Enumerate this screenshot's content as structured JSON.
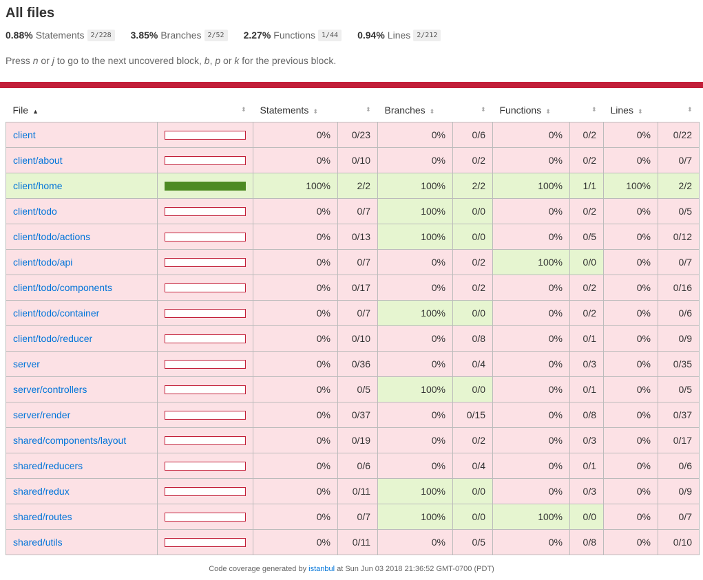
{
  "title": "All files",
  "summary": [
    {
      "pct": "0.88%",
      "label": "Statements",
      "fraction": "2/228"
    },
    {
      "pct": "3.85%",
      "label": "Branches",
      "fraction": "2/52"
    },
    {
      "pct": "2.27%",
      "label": "Functions",
      "fraction": "1/44"
    },
    {
      "pct": "0.94%",
      "label": "Lines",
      "fraction": "2/212"
    }
  ],
  "hint": {
    "p1": "Press ",
    "k1": "n",
    "p2": " or ",
    "k2": "j",
    "p3": " to go to the next uncovered block, ",
    "k3": "b",
    "p4": ", ",
    "k4": "p",
    "p5": " or ",
    "k5": "k",
    "p6": " for the previous block."
  },
  "headers": {
    "file": "File",
    "statements": "Statements",
    "branches": "Branches",
    "functions": "Functions",
    "lines": "Lines"
  },
  "colors": {
    "low": "#fce1e5",
    "high": "#e6f5d0",
    "bar_red": "#c21f39",
    "bar_green": "#4d8a23",
    "link": "#0074D9"
  },
  "rows": [
    {
      "file": "client",
      "cover": 0,
      "s_pct": "0%",
      "s_frac": "0/23",
      "b_pct": "0%",
      "b_frac": "0/6",
      "f_pct": "0%",
      "f_frac": "0/2",
      "l_pct": "0%",
      "l_frac": "0/22"
    },
    {
      "file": "client/about",
      "cover": 0,
      "s_pct": "0%",
      "s_frac": "0/10",
      "b_pct": "0%",
      "b_frac": "0/2",
      "f_pct": "0%",
      "f_frac": "0/2",
      "l_pct": "0%",
      "l_frac": "0/7"
    },
    {
      "file": "client/home",
      "cover": 100,
      "s_pct": "100%",
      "s_frac": "2/2",
      "b_pct": "100%",
      "b_frac": "2/2",
      "f_pct": "100%",
      "f_frac": "1/1",
      "l_pct": "100%",
      "l_frac": "2/2"
    },
    {
      "file": "client/todo",
      "cover": 0,
      "s_pct": "0%",
      "s_frac": "0/7",
      "b_pct": "100%",
      "b_frac": "0/0",
      "f_pct": "0%",
      "f_frac": "0/2",
      "l_pct": "0%",
      "l_frac": "0/5"
    },
    {
      "file": "client/todo/actions",
      "cover": 0,
      "s_pct": "0%",
      "s_frac": "0/13",
      "b_pct": "100%",
      "b_frac": "0/0",
      "f_pct": "0%",
      "f_frac": "0/5",
      "l_pct": "0%",
      "l_frac": "0/12"
    },
    {
      "file": "client/todo/api",
      "cover": 0,
      "s_pct": "0%",
      "s_frac": "0/7",
      "b_pct": "0%",
      "b_frac": "0/2",
      "f_pct": "100%",
      "f_frac": "0/0",
      "l_pct": "0%",
      "l_frac": "0/7"
    },
    {
      "file": "client/todo/components",
      "cover": 0,
      "s_pct": "0%",
      "s_frac": "0/17",
      "b_pct": "0%",
      "b_frac": "0/2",
      "f_pct": "0%",
      "f_frac": "0/2",
      "l_pct": "0%",
      "l_frac": "0/16"
    },
    {
      "file": "client/todo/container",
      "cover": 0,
      "s_pct": "0%",
      "s_frac": "0/7",
      "b_pct": "100%",
      "b_frac": "0/0",
      "f_pct": "0%",
      "f_frac": "0/2",
      "l_pct": "0%",
      "l_frac": "0/6"
    },
    {
      "file": "client/todo/reducer",
      "cover": 0,
      "s_pct": "0%",
      "s_frac": "0/10",
      "b_pct": "0%",
      "b_frac": "0/8",
      "f_pct": "0%",
      "f_frac": "0/1",
      "l_pct": "0%",
      "l_frac": "0/9"
    },
    {
      "file": "server",
      "cover": 0,
      "s_pct": "0%",
      "s_frac": "0/36",
      "b_pct": "0%",
      "b_frac": "0/4",
      "f_pct": "0%",
      "f_frac": "0/3",
      "l_pct": "0%",
      "l_frac": "0/35"
    },
    {
      "file": "server/controllers",
      "cover": 0,
      "s_pct": "0%",
      "s_frac": "0/5",
      "b_pct": "100%",
      "b_frac": "0/0",
      "f_pct": "0%",
      "f_frac": "0/1",
      "l_pct": "0%",
      "l_frac": "0/5"
    },
    {
      "file": "server/render",
      "cover": 0,
      "s_pct": "0%",
      "s_frac": "0/37",
      "b_pct": "0%",
      "b_frac": "0/15",
      "f_pct": "0%",
      "f_frac": "0/8",
      "l_pct": "0%",
      "l_frac": "0/37"
    },
    {
      "file": "shared/components/layout",
      "cover": 0,
      "s_pct": "0%",
      "s_frac": "0/19",
      "b_pct": "0%",
      "b_frac": "0/2",
      "f_pct": "0%",
      "f_frac": "0/3",
      "l_pct": "0%",
      "l_frac": "0/17"
    },
    {
      "file": "shared/reducers",
      "cover": 0,
      "s_pct": "0%",
      "s_frac": "0/6",
      "b_pct": "0%",
      "b_frac": "0/4",
      "f_pct": "0%",
      "f_frac": "0/1",
      "l_pct": "0%",
      "l_frac": "0/6"
    },
    {
      "file": "shared/redux",
      "cover": 0,
      "s_pct": "0%",
      "s_frac": "0/11",
      "b_pct": "100%",
      "b_frac": "0/0",
      "f_pct": "0%",
      "f_frac": "0/3",
      "l_pct": "0%",
      "l_frac": "0/9"
    },
    {
      "file": "shared/routes",
      "cover": 0,
      "s_pct": "0%",
      "s_frac": "0/7",
      "b_pct": "100%",
      "b_frac": "0/0",
      "f_pct": "100%",
      "f_frac": "0/0",
      "l_pct": "0%",
      "l_frac": "0/7"
    },
    {
      "file": "shared/utils",
      "cover": 0,
      "s_pct": "0%",
      "s_frac": "0/11",
      "b_pct": "0%",
      "b_frac": "0/5",
      "f_pct": "0%",
      "f_frac": "0/8",
      "l_pct": "0%",
      "l_frac": "0/10"
    }
  ],
  "footer": {
    "pre": "Code coverage generated by ",
    "link": "istanbul",
    "post": " at Sun Jun 03 2018 21:36:52 GMT-0700 (PDT)"
  }
}
